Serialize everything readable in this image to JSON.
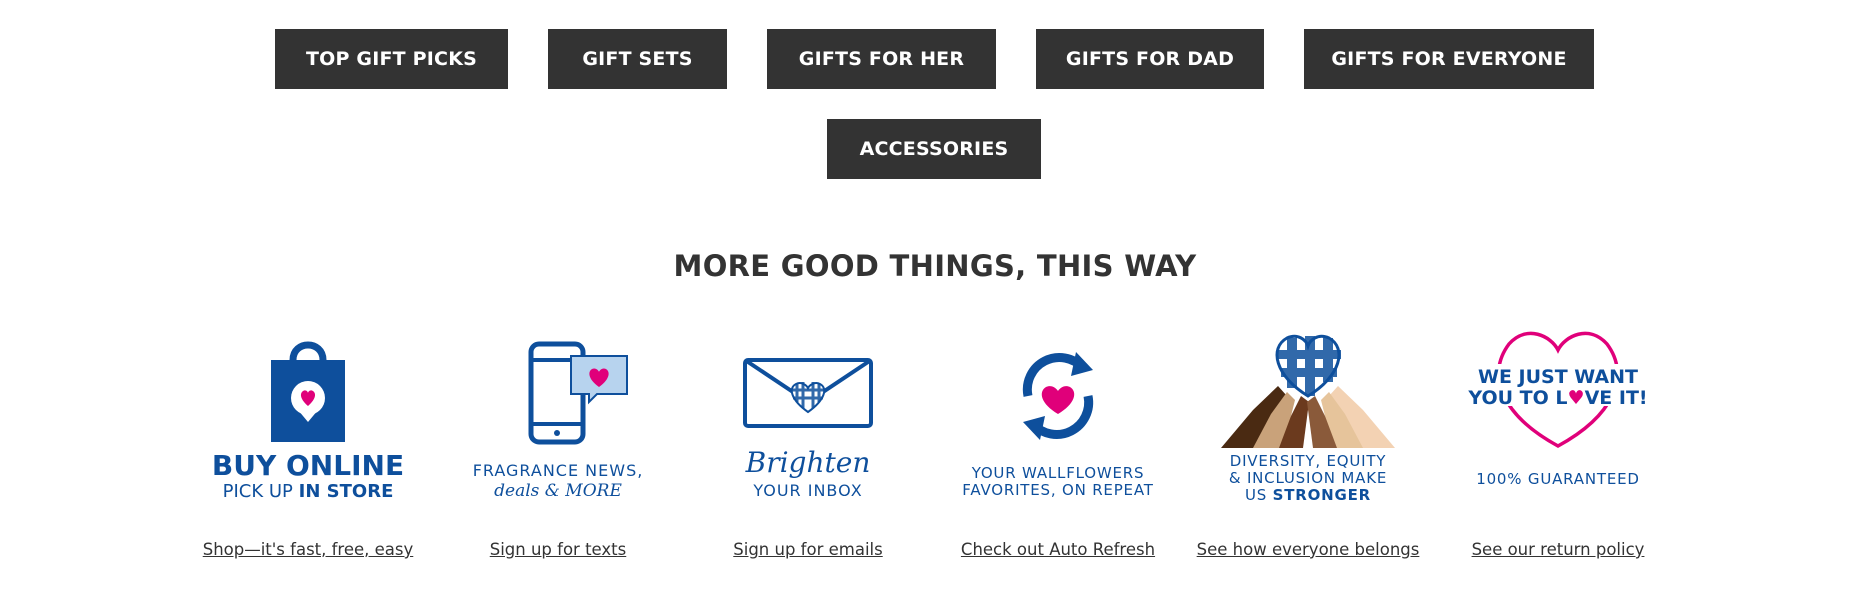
{
  "colors": {
    "button_bg": "#333333",
    "brand_blue": "#0e4f9c",
    "brand_pink": "#e0007a",
    "text": "#333333"
  },
  "gift_buttons": [
    {
      "label": "TOP GIFT PICKS"
    },
    {
      "label": "GIFT SETS"
    },
    {
      "label": "GIFTS FOR HER"
    },
    {
      "label": "GIFTS FOR DAD"
    },
    {
      "label": "GIFTS FOR EVERYONE"
    },
    {
      "label": "ACCESSORIES"
    }
  ],
  "section": {
    "title": "MORE GOOD THINGS, THIS WAY"
  },
  "cards": [
    {
      "icon": "shopping-bag-heart-icon",
      "headline_1": "BUY ONLINE",
      "headline_2a": "PICK UP ",
      "headline_2b": "IN STORE",
      "link": "Shop—it's fast, free, easy"
    },
    {
      "icon": "phone-message-heart-icon",
      "headline_1": "FRAGRANCE NEWS,",
      "headline_2": "deals & MORE",
      "link": "Sign up for texts"
    },
    {
      "icon": "envelope-heart-icon",
      "headline_1": "Brighten",
      "headline_2": "YOUR INBOX",
      "link": "Sign up for emails"
    },
    {
      "icon": "refresh-heart-icon",
      "headline_1": "YOUR WALLFLOWERS",
      "headline_2": "FAVORITES, ON REPEAT",
      "link": "Check out Auto Refresh"
    },
    {
      "icon": "hands-holding-heart-icon",
      "headline_1": "DIVERSITY, EQUITY",
      "headline_2": "& INCLUSION MAKE",
      "headline_3a": "US ",
      "headline_3b": "STRONGER",
      "link": "See how everyone belongs"
    },
    {
      "icon": "heart-outline-icon",
      "headline_1": "WE JUST WANT",
      "headline_2a": "YOU TO L",
      "headline_2b": "VE IT!",
      "headline_3": "100% GUARANTEED",
      "link": "See our return policy"
    }
  ]
}
